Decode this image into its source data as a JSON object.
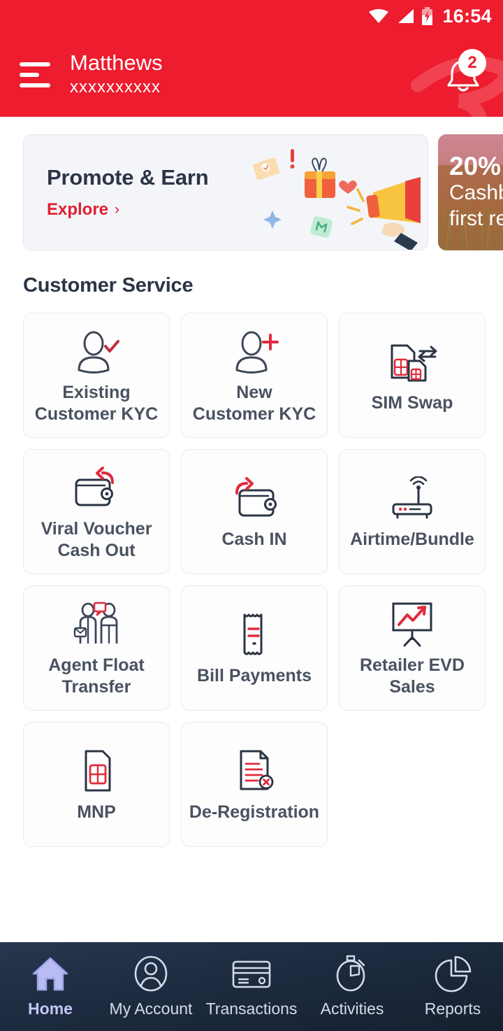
{
  "statusbar": {
    "time": "16:54",
    "icons": [
      "wifi-icon",
      "signal-icon",
      "battery-charging-icon"
    ]
  },
  "header": {
    "menu_icon": "hamburger-menu-icon",
    "name": "Matthews",
    "msisdn": "xxxxxxxxxx",
    "bell_icon": "notification-bell-icon",
    "notification_count": "2",
    "background_color": "#ED1C2E"
  },
  "banners": [
    {
      "id": "promote-earn",
      "title": "Promote & Earn",
      "cta": "Explore",
      "cta_chevron": "›",
      "art": "megaphone-gift-illustration",
      "bg": "#f4f5f9",
      "cta_color": "#E1202F"
    },
    {
      "id": "cashback",
      "percent": "20%",
      "line1": "Cashb",
      "line2": "first re",
      "art": "field-photo-background"
    }
  ],
  "section": {
    "title": "Customer Service"
  },
  "tiles": [
    {
      "label": "Existing\nCustomer KYC",
      "icon": "person-check-icon",
      "name": "existing-customer-kyc"
    },
    {
      "label": "New\nCustomer KYC",
      "icon": "person-plus-icon",
      "name": "new-customer-kyc"
    },
    {
      "label": "SIM Swap",
      "icon": "sim-swap-icon",
      "name": "sim-swap"
    },
    {
      "label": "Viral Voucher\nCash Out",
      "icon": "wallet-out-icon",
      "name": "viral-voucher-cash-out"
    },
    {
      "label": "Cash IN",
      "icon": "wallet-in-icon",
      "name": "cash-in"
    },
    {
      "label": "Airtime/Bundle",
      "icon": "router-wifi-icon",
      "name": "airtime-bundle"
    },
    {
      "label": "Agent Float\nTransfer",
      "icon": "two-people-icon",
      "name": "agent-float-transfer"
    },
    {
      "label": "Bill Payments",
      "icon": "receipt-icon",
      "name": "bill-payments"
    },
    {
      "label": "Retailer EVD\nSales",
      "icon": "chart-board-icon",
      "name": "retailer-evd-sales"
    },
    {
      "label": "MNP",
      "icon": "sim-card-icon",
      "name": "mnp"
    },
    {
      "label": "De-Registration",
      "icon": "document-x-icon",
      "name": "de-registration"
    }
  ],
  "bottomnav": {
    "active": "Home",
    "items": [
      {
        "label": "Home",
        "icon": "home-icon",
        "name": "nav-home"
      },
      {
        "label": "My Account",
        "icon": "user-circle-icon",
        "name": "nav-my-account"
      },
      {
        "label": "Transactions",
        "icon": "card-icon",
        "name": "nav-transactions"
      },
      {
        "label": "Activities",
        "icon": "stopwatch-icon",
        "name": "nav-activities"
      },
      {
        "label": "Reports",
        "icon": "pie-chart-icon",
        "name": "nav-reports"
      }
    ]
  },
  "colors": {
    "brand_red": "#ED1C2E",
    "text_dark": "#2c3545",
    "tile_text": "#4a5260",
    "nav_active": "#c3c6f5"
  }
}
